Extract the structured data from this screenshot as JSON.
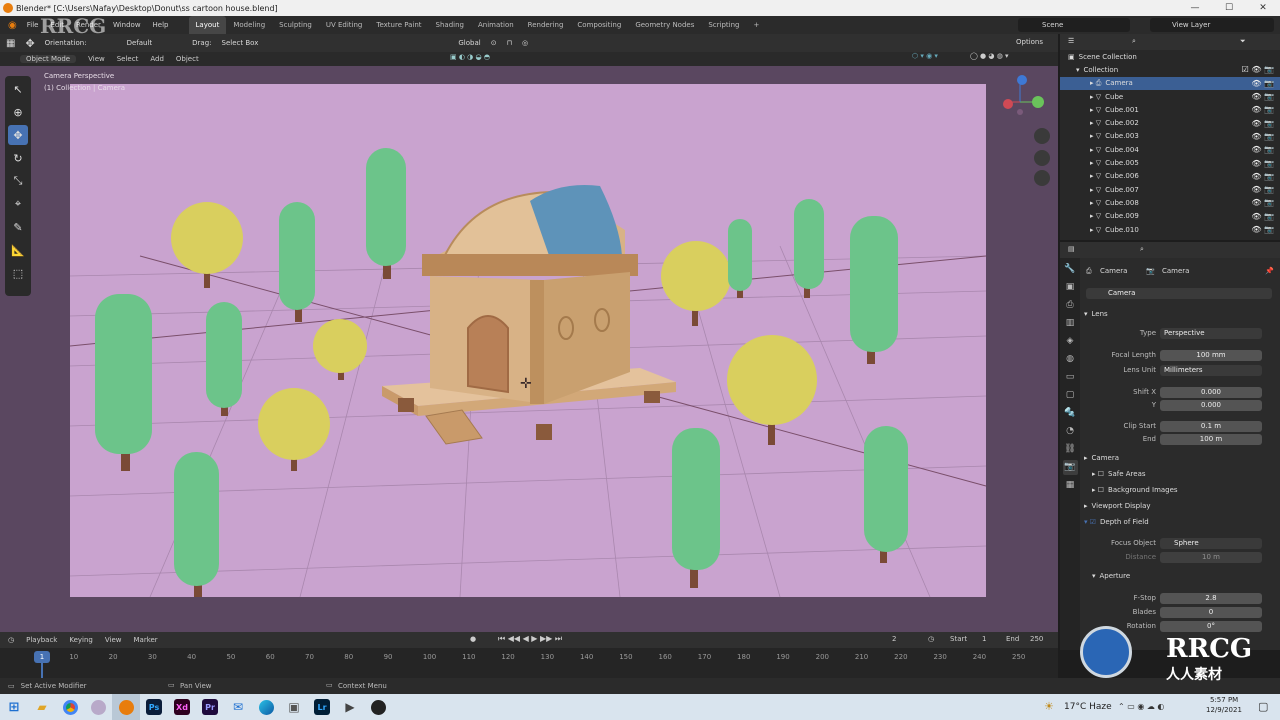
{
  "window": {
    "title": "Blender* [C:\\Users\\Nafay\\Desktop\\Donut\\ss cartoon house.blend]",
    "min": "—",
    "max": "☐",
    "close": "✕"
  },
  "menu": {
    "items": [
      "File",
      "Edit",
      "Render",
      "Window",
      "Help"
    ],
    "workspaces": [
      "Layout",
      "Modeling",
      "Sculpting",
      "UV Editing",
      "Texture Paint",
      "Shading",
      "Animation",
      "Rendering",
      "Compositing",
      "Geometry Nodes",
      "Scripting"
    ],
    "add_tab": "+",
    "scene_label": "Scene",
    "view_layer_label": "View Layer"
  },
  "viewport_header": {
    "orientation_label": "Orientation:",
    "orientation_value": "Default",
    "drag_label": "Drag:",
    "drag_value": "Select Box",
    "transform_orientation": "Global",
    "options_label": "Options",
    "mode": "Object Mode",
    "menus": [
      "View",
      "Select",
      "Add",
      "Object"
    ]
  },
  "viewport": {
    "overlay_line1": "Camera Perspective",
    "overlay_line2": "(1) Collection | Camera"
  },
  "outliner": {
    "scene_collection": "Scene Collection",
    "collection": "Collection",
    "objects": [
      "Camera",
      "Cube",
      "Cube.001",
      "Cube.002",
      "Cube.003",
      "Cube.004",
      "Cube.005",
      "Cube.006",
      "Cube.007",
      "Cube.008",
      "Cube.009",
      "Cube.010"
    ],
    "selected": "Camera"
  },
  "properties": {
    "breadcrumb_left": "Camera",
    "breadcrumb_right": "Camera",
    "data_name": "Camera",
    "lens_section": "Lens",
    "type_label": "Type",
    "type_value": "Perspective",
    "focal_length_label": "Focal Length",
    "focal_length_value": "100 mm",
    "lens_unit_label": "Lens Unit",
    "lens_unit_value": "Millimeters",
    "shift_x_label": "Shift X",
    "shift_x_value": "0.000",
    "shift_y_label": "Y",
    "shift_y_value": "0.000",
    "clip_start_label": "Clip Start",
    "clip_start_value": "0.1 m",
    "clip_end_label": "End",
    "clip_end_value": "100 m",
    "camera_section": "Camera",
    "safe_areas": "Safe Areas",
    "background_images": "Background Images",
    "viewport_display": "Viewport Display",
    "dof_section": "Depth of Field",
    "focus_object_label": "Focus Object",
    "focus_object_value": "Sphere",
    "distance_label": "Distance",
    "distance_value": "10 m",
    "aperture_section": "Aperture",
    "fstop_label": "F-Stop",
    "fstop_value": "2.8",
    "blades_label": "Blades",
    "blades_value": "0",
    "rotation_label": "Rotation",
    "rotation_value": "0°"
  },
  "timeline": {
    "menus": [
      "Playback",
      "Keying",
      "View",
      "Marker"
    ],
    "current_frame": "1",
    "start_label": "Start",
    "start_value": "1",
    "end_label": "End",
    "end_value": "250",
    "ticks": [
      "1",
      "10",
      "20",
      "30",
      "40",
      "50",
      "60",
      "70",
      "80",
      "90",
      "100",
      "110",
      "120",
      "130",
      "140",
      "150",
      "160",
      "170",
      "180",
      "190",
      "200",
      "210",
      "220",
      "230",
      "240",
      "250"
    ],
    "frame_display": "2"
  },
  "statusbar": {
    "left": "Set Active Modifier",
    "middle": "Pan View",
    "right": "Context Menu"
  },
  "taskbar": {
    "apps": [
      "Ps",
      "Xd",
      "Pr",
      "Lr"
    ],
    "weather": "17°C Haze",
    "time": "5:57 PM",
    "date": "12/9/2021"
  },
  "watermark": {
    "brand": "RRCG",
    "cn": "人人素材"
  },
  "colors": {
    "accent": "#4772b3",
    "viewport_bg": "#5a4760",
    "camera_frame": "#c9a3cf",
    "tree_green": "#6cc48a",
    "tree_yellow": "#d9cf5e",
    "house_wood": "#c99a6a",
    "roof_blue": "#5e93b9"
  }
}
